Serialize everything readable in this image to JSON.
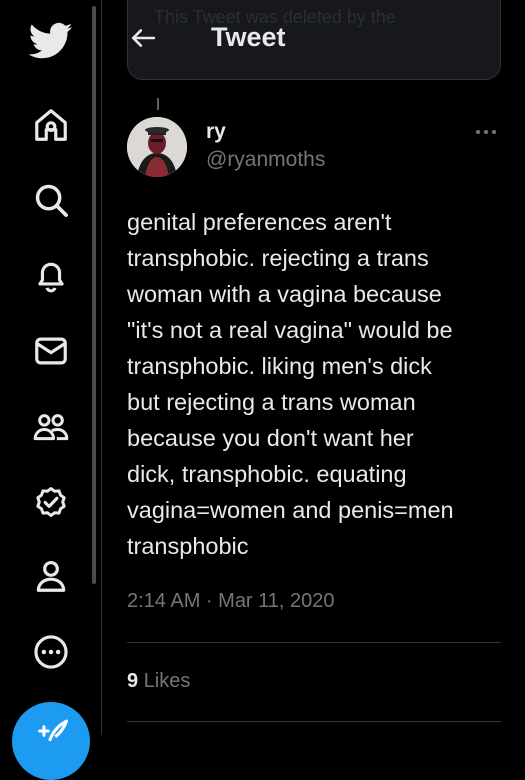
{
  "nav": {
    "items": [
      {
        "icon": "twitter-logo-icon"
      },
      {
        "icon": "home-icon"
      },
      {
        "icon": "search-icon"
      },
      {
        "icon": "notifications-icon"
      },
      {
        "icon": "messages-icon"
      },
      {
        "icon": "communities-icon"
      },
      {
        "icon": "verified-icon"
      },
      {
        "icon": "profile-icon"
      },
      {
        "icon": "more-circle-icon"
      }
    ],
    "compose_icon": "compose-icon",
    "accent_color": "#1d9bf0"
  },
  "quoted": {
    "text": "This Tweet was deleted by the"
  },
  "header": {
    "title": "Tweet"
  },
  "tweet": {
    "author_name": "ry",
    "author_handle": "@ryanmoths",
    "text": "genital preferences aren't\ntransphobic. rejecting a trans\nwoman with a vagina because\n\"it's not a real vagina\" would be\ntransphobic. liking men's dick\nbut rejecting a trans woman\nbecause you don't want her\ndick, transphobic. equating\nvagina=women and penis=men\ntransphobic",
    "timestamp": "2:14 AM · Mar 11, 2020",
    "likes_count": "9",
    "likes_label": "Likes"
  }
}
